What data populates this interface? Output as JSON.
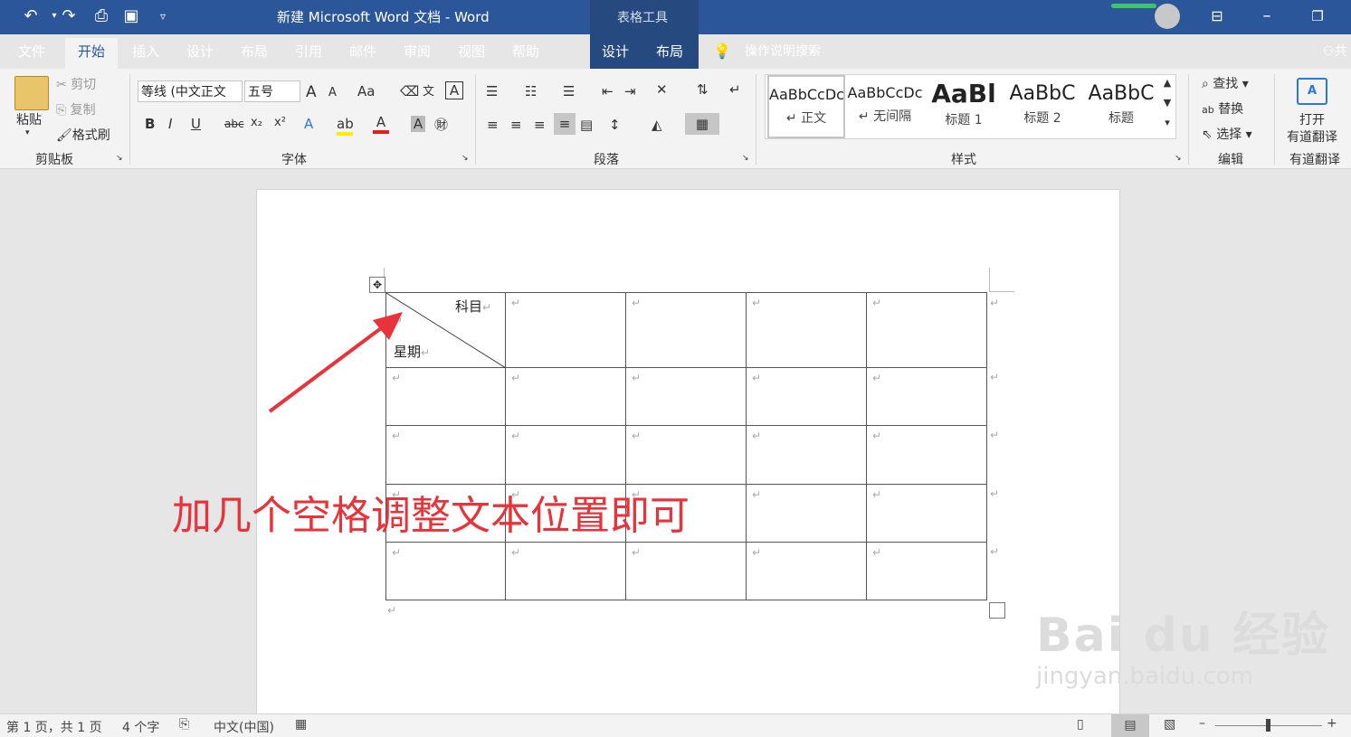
{
  "window": {
    "title": "新建 Microsoft Word 文档  -  Word",
    "context_group": "表格工具"
  },
  "tabs": [
    "文件",
    "开始",
    "插入",
    "设计",
    "布局",
    "引用",
    "邮件",
    "审阅",
    "视图",
    "帮助"
  ],
  "context_tabs": [
    "设计",
    "布局"
  ],
  "tell_me": "操作说明搜索",
  "share_label": "共",
  "clipboard": {
    "paste": "粘贴",
    "cut": "剪切",
    "copy": "复制",
    "format_painter": "格式刷",
    "label": "剪贴板"
  },
  "font": {
    "name": "等线 (中文正文",
    "size": "五号",
    "label": "字体",
    "bold": "B",
    "italic": "I",
    "underline": "U",
    "strike": "abc",
    "sub": "x₂",
    "sup": "x²",
    "grow": "A",
    "shrink": "A",
    "case": "Aa"
  },
  "paragraph": {
    "label": "段落"
  },
  "styles": {
    "label": "样式",
    "items": [
      {
        "preview": "AaBbCcDc",
        "name": "↵ 正文"
      },
      {
        "preview": "AaBbCcDc",
        "name": "↵ 无间隔"
      },
      {
        "preview": "AaBl",
        "name": "标题 1"
      },
      {
        "preview": "AaBbC",
        "name": "标题 2"
      },
      {
        "preview": "AaBbC",
        "name": "标题"
      }
    ]
  },
  "editing": {
    "label": "编辑",
    "find": "查找",
    "replace": "替换",
    "select": "选择"
  },
  "youdao": {
    "line1": "打开",
    "line2": "有道翻译",
    "label": "有道翻译"
  },
  "table": {
    "header_top": "科目",
    "header_bottom": "星期",
    "pilcrow": "↵"
  },
  "annotation": "加几个空格调整文本位置即可",
  "statusbar": {
    "page": "第 1 页，共 1 页",
    "words": "4 个字",
    "lang": "中文(中国)"
  },
  "watermark": {
    "brand": "Bai du 经验",
    "url": "jingyan.baidu.com"
  },
  "colors": {
    "accent": "#2b579a",
    "annotation": "#e8333a"
  }
}
